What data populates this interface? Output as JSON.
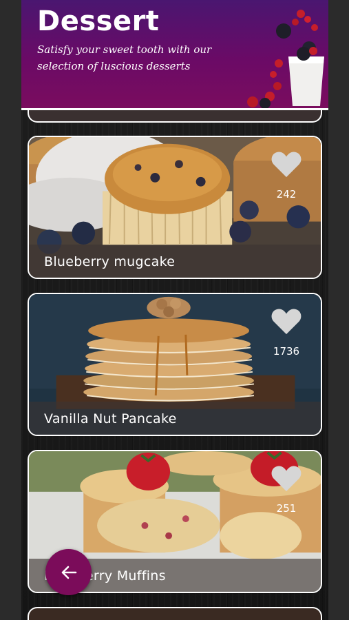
{
  "header": {
    "title": "Dessert",
    "subtitle": "Satisfy your sweet tooth with our selection of luscious desserts"
  },
  "cards": [
    {
      "name": "Blueberry mugcake",
      "likes": "242",
      "liked": false
    },
    {
      "name": "Vanilla Nut Pancake",
      "likes": "1736",
      "liked": false
    },
    {
      "name": "Raspberry Muffins",
      "likes": "251",
      "liked": false
    }
  ],
  "icons": {
    "heart": "heart-icon",
    "back": "arrow-left-icon"
  },
  "colors": {
    "header_top": "#4a1670",
    "header_bottom": "#7b0d5e",
    "fab": "#7b0c5a",
    "card_border": "#ffffff"
  }
}
